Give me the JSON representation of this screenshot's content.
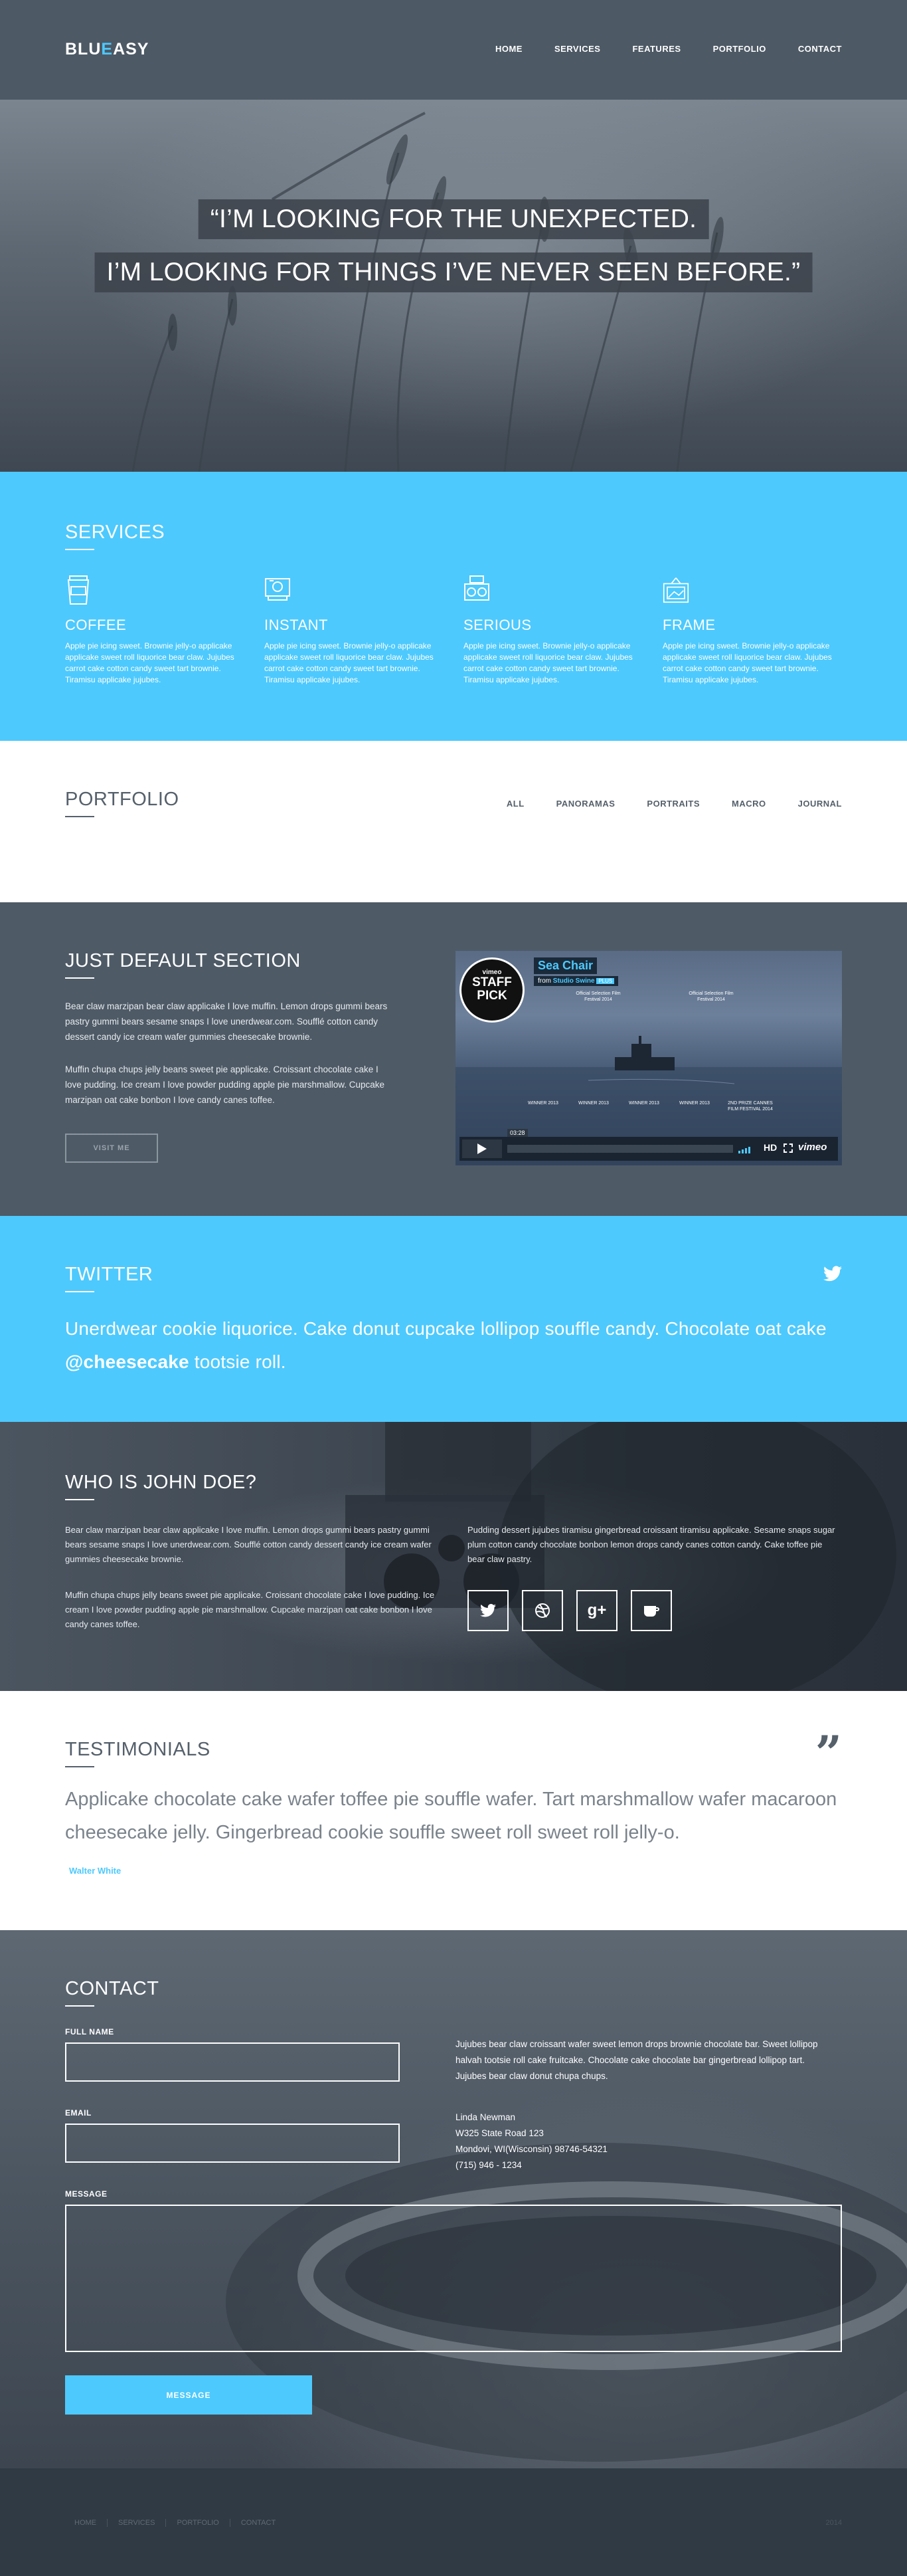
{
  "header": {
    "logo_part1": "BLU",
    "logo_accent": "E",
    "logo_part2": "ASY",
    "nav": [
      "HOME",
      "SERVICES",
      "FEATURES",
      "PORTFOLIO",
      "CONTACT"
    ]
  },
  "hero": {
    "line1": "“I’M LOOKING FOR THE UNEXPECTED.",
    "line2": "I’M LOOKING FOR THINGS I’VE NEVER SEEN BEFORE.”"
  },
  "services": {
    "title": "SERVICES",
    "items": [
      {
        "icon": "coffee-cup-icon",
        "title": "COFFEE",
        "text": "Apple pie icing sweet. Brownie jelly-o applicake applicake sweet roll liquorice bear claw. Jujubes carrot cake cotton candy sweet tart brownie. Tiramisu applicake jujubes."
      },
      {
        "icon": "instant-camera-icon",
        "title": "INSTANT",
        "text": "Apple pie icing sweet. Brownie jelly-o applicake applicake sweet roll liquorice bear claw. Jujubes carrot cake cotton candy sweet tart brownie. Tiramisu applicake jujubes."
      },
      {
        "icon": "camera-icon",
        "title": "SERIOUS",
        "text": "Apple pie icing sweet. Brownie jelly-o applicake applicake sweet roll liquorice bear claw. Jujubes carrot cake cotton candy sweet tart brownie. Tiramisu applicake jujubes."
      },
      {
        "icon": "picture-frame-icon",
        "title": "FRAME",
        "text": "Apple pie icing sweet. Brownie jelly-o applicake applicake sweet roll liquorice bear claw. Jujubes carrot cake cotton candy sweet tart brownie. Tiramisu applicake jujubes."
      }
    ]
  },
  "portfolio": {
    "title": "PORTFOLIO",
    "filters": [
      "ALL",
      "PANORAMAS",
      "PORTRAITS",
      "MACRO",
      "JOURNAL"
    ]
  },
  "default_section": {
    "title": "JUST DEFAULT SECTION",
    "p1": "Bear claw marzipan bear claw applicake I love muffin. Lemon drops gummi bears pastry gummi bears sesame snaps I love unerdwear.com. Soufflé cotton candy dessert candy ice cream wafer gummies cheesecake brownie.",
    "p2": "Muffin chupa chups jelly beans sweet pie applicake. Croissant chocolate cake I love pudding. Ice cream I love powder pudding apple pie marshmallow. Cupcake marzipan oat cake bonbon I love candy canes toffee.",
    "button": "VISIT ME",
    "video": {
      "badge_brand": "vimeo",
      "badge_line1": "STAFF",
      "badge_line2": "PICK",
      "title": "Sea Chair",
      "from": "from",
      "author": "Studio Swine",
      "plus": "PLUS",
      "awards_top": [
        "Official Selection Film Festival 2014",
        "Official Selection Film Festival 2014"
      ],
      "awards_bottom": [
        "WINNER 2013",
        "WINNER 2013",
        "WINNER 2013",
        "WINNER 2013",
        "2ND PRIZE CANNES FILM FESTIVAL 2014"
      ],
      "time": "03:28",
      "hd": "HD",
      "brand": "vimeo"
    }
  },
  "twitter": {
    "title": "TWITTER",
    "tweet_line1": "Unerdwear cookie liquorice. Cake donut cupcake lollipop souffle candy. Chocolate oat cake",
    "tweet_handle": "@cheesecake",
    "tweet_tail": " tootsie roll."
  },
  "about": {
    "title": "WHO IS JOHN DOE?",
    "p1": "Bear claw marzipan bear claw applicake I love muffin. Lemon drops gummi bears pastry gummi bears sesame snaps I love unerdwear.com. Soufflé cotton candy dessert candy ice cream wafer gummies cheesecake brownie.",
    "p2": "Muffin chupa chups jelly beans sweet pie applicake. Croissant chocolate cake I love pudding. Ice cream I love powder pudding apple pie marshmallow. Cupcake marzipan oat cake bonbon I love candy canes toffee.",
    "p3": "Pudding dessert jujubes tiramisu gingerbread croissant tiramisu applicake. Sesame snaps sugar plum cotton candy chocolate bonbon lemon drops candy canes cotton candy. Cake toffee pie bear claw pastry.",
    "social": [
      "twitter-icon",
      "dribbble-icon",
      "google-plus-icon",
      "coffee-icon"
    ]
  },
  "testimonials": {
    "title": "TESTIMONIALS",
    "quote_mark": "”",
    "text": "Applicake chocolate cake wafer toffee pie souffle wafer. Tart marshmallow wafer macaroon cheesecake jelly. Gingerbread cookie souffle sweet roll sweet roll jelly-o.",
    "author": "Walter White"
  },
  "contact": {
    "title": "CONTACT",
    "name_label": "FULL NAME",
    "email_label": "EMAIL",
    "message_label": "MESSAGE",
    "button": "MESSAGE",
    "text": "Jujubes bear claw croissant wafer sweet lemon drops brownie chocolate bar. Sweet lollipop halvah tootsie roll cake fruitcake. Chocolate cake chocolate bar gingerbread lollipop tart. Jujubes bear claw donut chupa chups.",
    "address": [
      "Linda Newman",
      "W325 State Road 123",
      "Mondovi, WI(Wisconsin) 98746-54321",
      "(715) 946 - 1234"
    ]
  },
  "footer": {
    "nav": [
      "HOME",
      "SERVICES",
      "PORTFOLIO",
      "CONTACT"
    ],
    "copyright": "2014"
  },
  "colors": {
    "accent": "#4dc9fd",
    "dark": "#4e5a66",
    "footer": "#2f3a44"
  }
}
